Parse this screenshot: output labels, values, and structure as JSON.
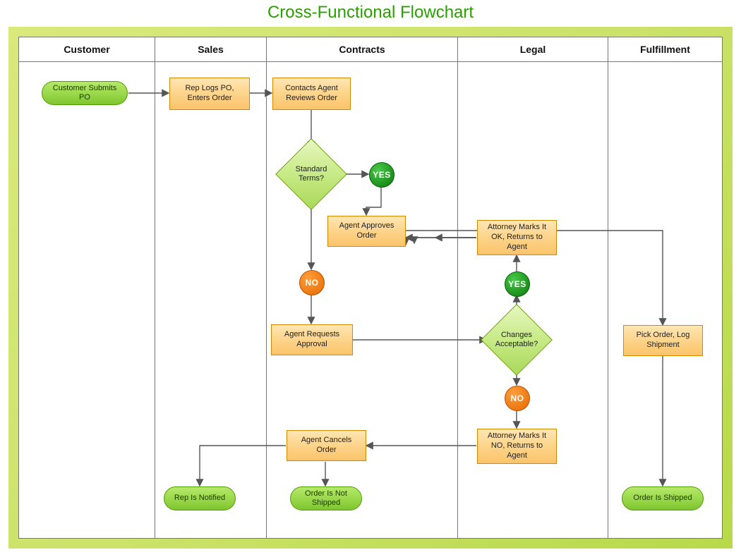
{
  "title": "Cross-Functional Flowchart",
  "lanes": [
    "Customer",
    "Sales",
    "Contracts",
    "Legal",
    "Fulfillment"
  ],
  "nodes": {
    "start": "Customer Submits PO",
    "repLogs": "Rep Logs PO, Enters Order",
    "agentReviews": "Contacts Agent Reviews Order",
    "standardTerms": "Standard Terms?",
    "approves": "Agent Approves Order",
    "requests": "Agent Requests Approval",
    "changes": "Changes Acceptable?",
    "attOk": "Attorney Marks It OK, Returns to Agent",
    "attNo": "Attorney Marks It NO, Returns to Agent",
    "cancels": "Agent Cancels Order",
    "notShipped": "Order Is Not Shipped",
    "repNotified": "Rep Is Notified",
    "pick": "Pick Order, Log Shipment",
    "shipped": "Order Is Shipped"
  },
  "badges": {
    "yes": "YES",
    "no": "NO"
  }
}
